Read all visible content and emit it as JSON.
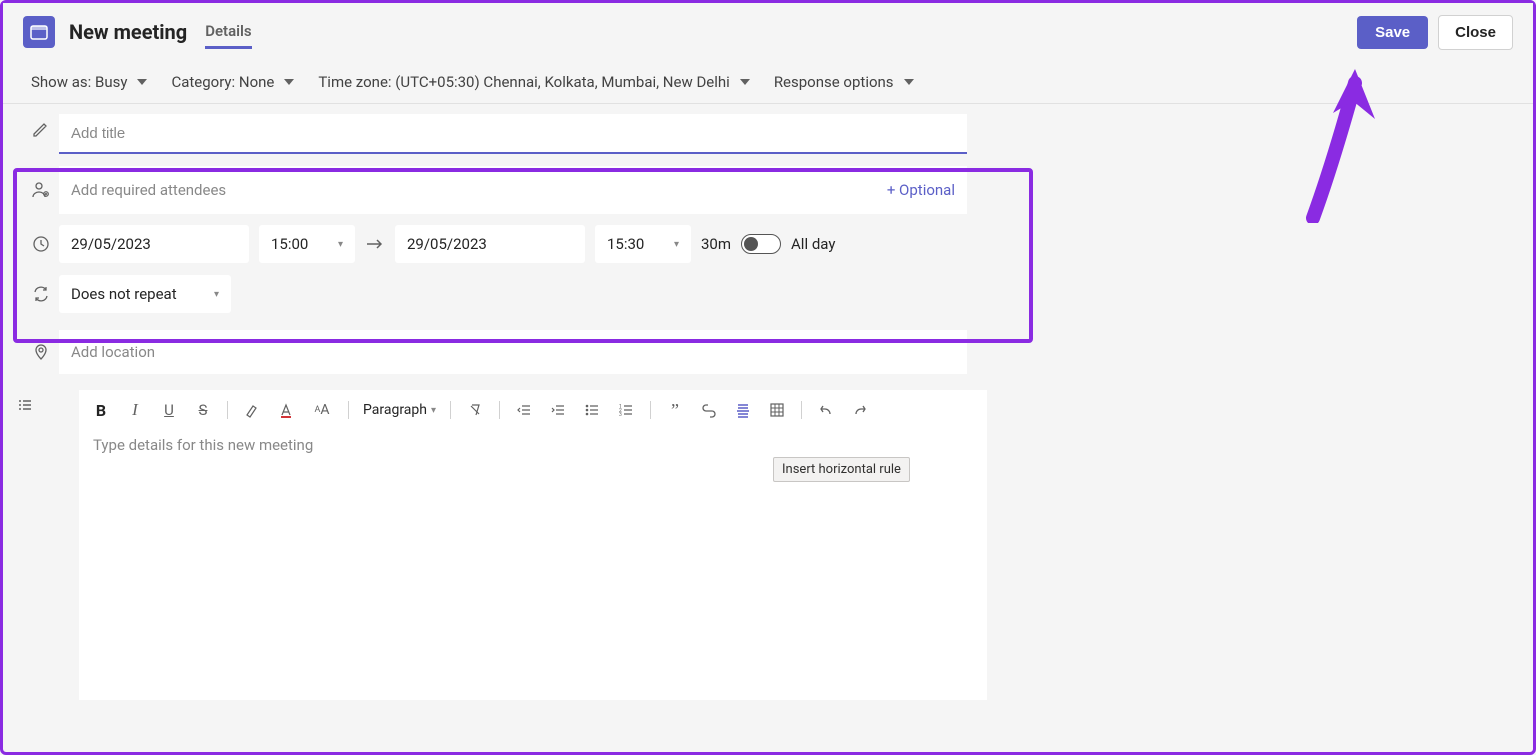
{
  "header": {
    "title": "New meeting",
    "tab": "Details",
    "save": "Save",
    "close": "Close"
  },
  "subbar": {
    "show_as": "Show as: Busy",
    "category": "Category: None",
    "timezone": "Time zone: (UTC+05:30) Chennai, Kolkata, Mumbai, New Delhi",
    "response": "Response options"
  },
  "form": {
    "title_placeholder": "Add title",
    "attendees_placeholder": "Add required attendees",
    "optional": "+ Optional",
    "start_date": "29/05/2023",
    "start_time": "15:00",
    "end_date": "29/05/2023",
    "end_time": "15:30",
    "duration": "30m",
    "all_day": "All day",
    "repeat": "Does not repeat",
    "location_placeholder": "Add location",
    "paragraph": "Paragraph",
    "details_placeholder": "Type details for this new meeting"
  },
  "tooltip": "Insert horizontal rule"
}
